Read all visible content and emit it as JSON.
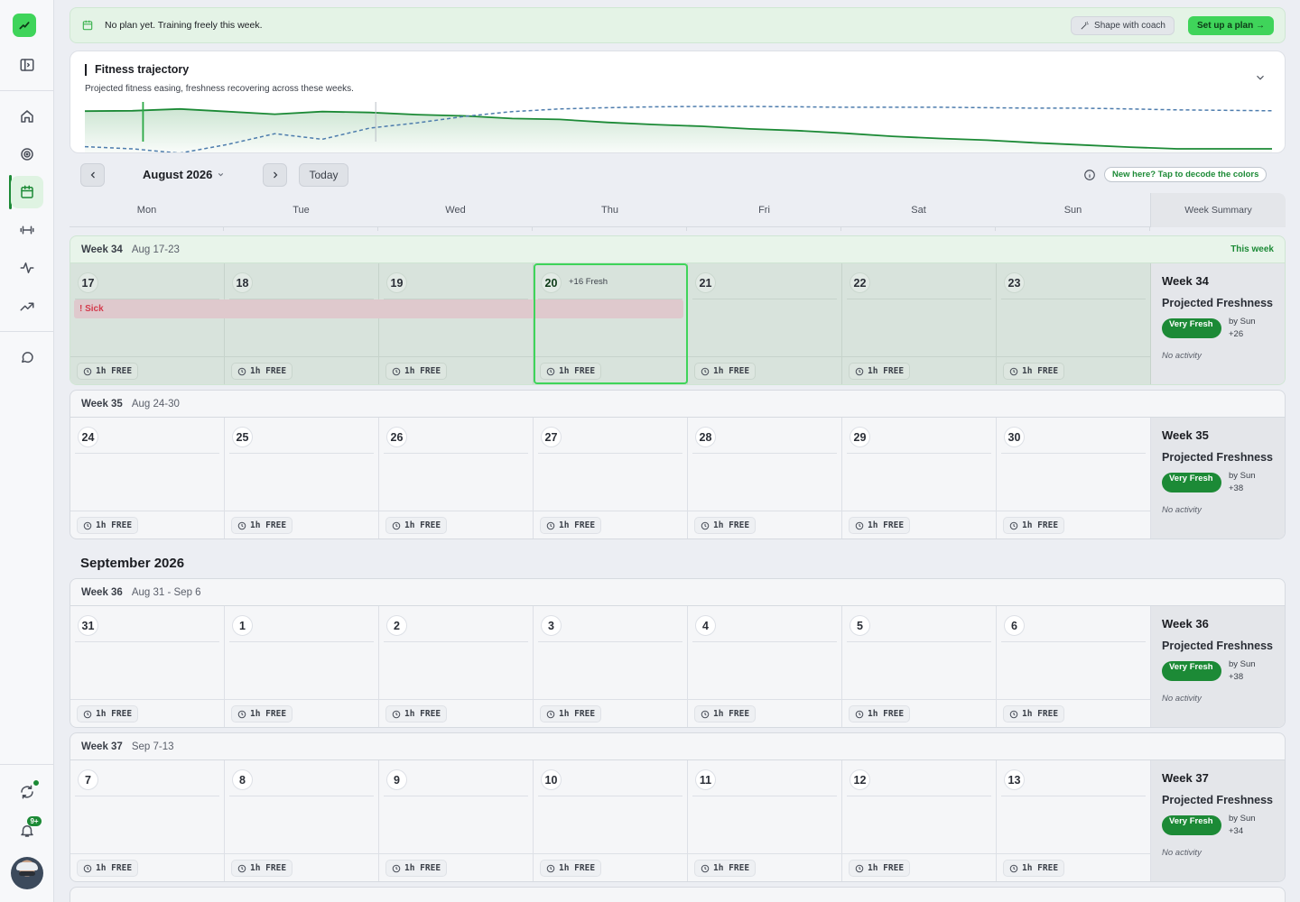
{
  "sidebar": {
    "items": [
      {
        "name": "home-icon"
      },
      {
        "name": "target-icon"
      },
      {
        "name": "calendar-icon",
        "active": true
      },
      {
        "name": "dumbbell-icon"
      },
      {
        "name": "activity-icon"
      },
      {
        "name": "trending-up-icon"
      },
      {
        "name": "chat-icon"
      }
    ],
    "notifications_count": "9+"
  },
  "banner": {
    "text": "No plan yet. Training freely this week.",
    "coach_button": "Shape with coach",
    "plan_button": "Set up a plan →"
  },
  "trajectory": {
    "title": "Fitness trajectory",
    "subtitle": "Projected fitness easing, freshness recovering across these weeks.",
    "chart_data": {
      "type": "line",
      "series": [
        {
          "color": "#1c8a36",
          "style": "solid-area",
          "values": [
            0.87,
            0.88,
            0.92,
            0.86,
            0.8,
            0.86,
            0.84,
            0.79,
            0.76,
            0.7,
            0.68,
            0.61,
            0.56,
            0.52,
            0.46,
            0.42,
            0.36,
            0.29,
            0.24,
            0.2,
            0.14,
            0.09,
            0.04,
            0.0,
            0.0,
            0.0
          ]
        },
        {
          "color": "#4d7cad",
          "style": "dashed",
          "values": [
            0.05,
            0.0,
            -0.1,
            0.1,
            0.35,
            0.22,
            0.48,
            0.6,
            0.75,
            0.86,
            0.92,
            0.95,
            0.97,
            0.98,
            0.98,
            0.97,
            0.96,
            0.96,
            0.96,
            0.95,
            0.94,
            0.94,
            0.92,
            0.9,
            0.89,
            0.88
          ]
        }
      ],
      "markers": [
        0.049,
        0.245
      ]
    }
  },
  "controls": {
    "month": "August 2026",
    "today": "Today",
    "decode": "New here? Tap to decode the colors"
  },
  "day_headers": [
    "Mon",
    "Tue",
    "Wed",
    "Thu",
    "Fri",
    "Sat",
    "Sun"
  ],
  "week_summary_header": "Week Summary",
  "free_label": "1h FREE",
  "summary_labels": {
    "projected": "Projected Freshness",
    "pill": "Very Fresh",
    "by": "by Sun",
    "no_activity": "No activity"
  },
  "september_label": "September 2026",
  "weeks": [
    {
      "label": "Week 34",
      "range": "Aug 17-23",
      "current": true,
      "this_week": "This week",
      "days": [
        "17",
        "18",
        "19",
        "20",
        "21",
        "22",
        "23"
      ],
      "today_index": 3,
      "today_fresh": "+16 Fresh",
      "sick": "! Sick",
      "summary_title": "Week 34",
      "delta": "+26"
    },
    {
      "label": "Week 35",
      "range": "Aug 24-30",
      "days": [
        "24",
        "25",
        "26",
        "27",
        "28",
        "29",
        "30"
      ],
      "summary_title": "Week 35",
      "delta": "+38"
    },
    {
      "label": "Week 36",
      "range": "Aug 31 - Sep 6",
      "days": [
        "31",
        "1",
        "2",
        "3",
        "4",
        "5",
        "6"
      ],
      "summary_title": "Week 36",
      "delta": "+38"
    },
    {
      "label": "Week 37",
      "range": "Sep 7-13",
      "days": [
        "7",
        "8",
        "9",
        "10",
        "11",
        "12",
        "13"
      ],
      "summary_title": "Week 37",
      "delta": "+34"
    }
  ]
}
